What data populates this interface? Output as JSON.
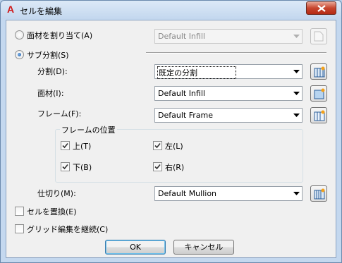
{
  "title": "セルを編集",
  "assign_material": {
    "label": "面材を割り当て(A)",
    "selected": false,
    "value": "Default Infill"
  },
  "subdivision": {
    "label": "サブ分割(S)",
    "selected": true
  },
  "division": {
    "label": "分割(D):",
    "value": "既定の分割"
  },
  "material": {
    "label": "面材(I):",
    "value": "Default Infill"
  },
  "frame": {
    "label": "フレーム(F):",
    "value": "Default Frame"
  },
  "frame_position": {
    "title": "フレームの位置",
    "top": {
      "label": "上(T)",
      "checked": true
    },
    "left": {
      "label": "左(L)",
      "checked": true
    },
    "bottom": {
      "label": "下(B)",
      "checked": true
    },
    "right": {
      "label": "右(R)",
      "checked": true
    }
  },
  "mullion": {
    "label": "仕切り(M):",
    "value": "Default Mullion"
  },
  "replace_cell": {
    "label": "セルを置換(E)",
    "checked": false
  },
  "continue_grid_edit": {
    "label": "グリッド編集を継続(C)",
    "checked": false
  },
  "buttons": {
    "ok": "OK",
    "cancel": "キャンセル"
  },
  "colors": {
    "accent": "#1c5aa8",
    "title_bg": "#c4d8ef",
    "close": "#c7452e"
  }
}
